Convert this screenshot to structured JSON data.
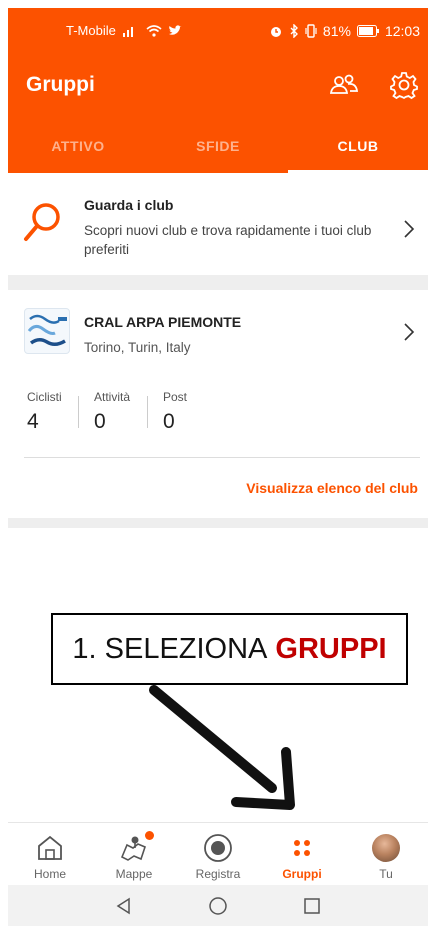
{
  "status_bar": {
    "carrier": "T-Mobile",
    "battery": "81%",
    "time": "12:03"
  },
  "header": {
    "title": "Gruppi",
    "icons": [
      "friends-icon",
      "settings-gear-icon"
    ]
  },
  "tabs": [
    {
      "label": "ATTIVO",
      "active": false
    },
    {
      "label": "SFIDE",
      "active": false
    },
    {
      "label": "CLUB",
      "active": true
    }
  ],
  "browse": {
    "title": "Guarda i club",
    "description": "Scopri nuovi club e trova rapidamente i tuoi club preferiti",
    "icon": "search-icon"
  },
  "club": {
    "name": "CRAL ARPA PIEMONTE",
    "location": "Torino, Turin, Italy",
    "stats": [
      {
        "label": "Ciclisti",
        "value": "4"
      },
      {
        "label": "Attività",
        "value": "0"
      },
      {
        "label": "Post",
        "value": "0"
      }
    ],
    "link": "Visualizza elenco del club"
  },
  "annotation": {
    "prefix": "1. SELEZIONA",
    "emphasis": "GRUPPI"
  },
  "bottom_nav": [
    {
      "label": "Home",
      "icon": "home-icon",
      "active": false
    },
    {
      "label": "Mappe",
      "icon": "maps-icon",
      "active": false,
      "badge": true
    },
    {
      "label": "Registra",
      "icon": "record-icon",
      "active": false
    },
    {
      "label": "Gruppi",
      "icon": "groups-icon",
      "active": true
    },
    {
      "label": "Tu",
      "icon": "avatar",
      "active": false
    }
  ],
  "colors": {
    "brand": "#fc5200",
    "annotation_emphasis": "#c00000"
  }
}
